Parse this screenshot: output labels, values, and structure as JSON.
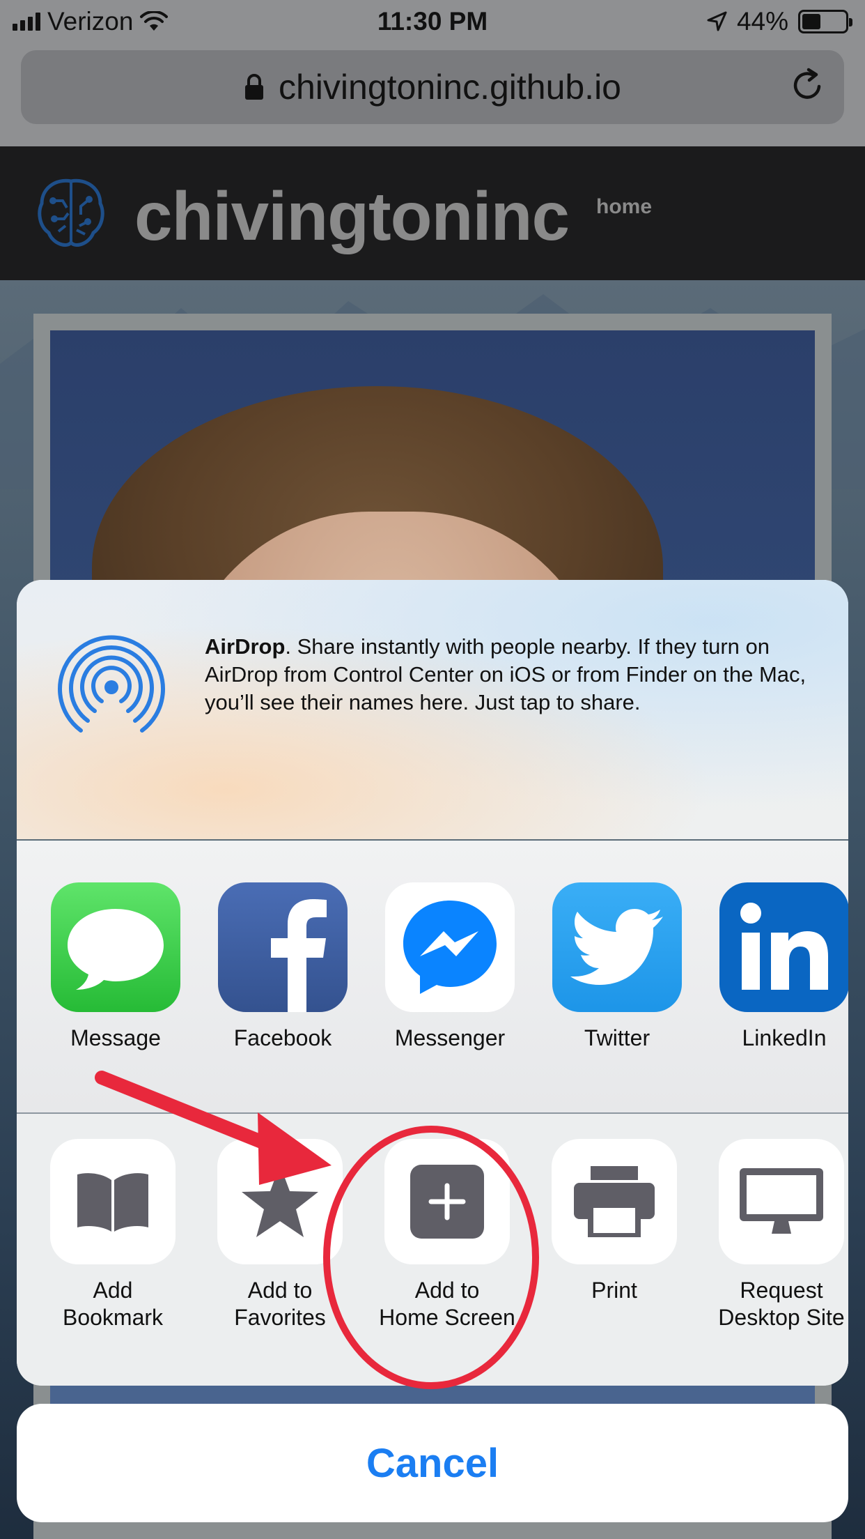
{
  "status_bar": {
    "carrier": "Verizon",
    "time": "11:30 PM",
    "battery": "44%",
    "battery_level": 0.44
  },
  "browser": {
    "url": "chivingtoninc.github.io"
  },
  "site": {
    "title": "chivingtoninc",
    "nav_home": "home"
  },
  "share_sheet": {
    "airdrop": {
      "title": "AirDrop",
      "description": ". Share instantly with people nearby. If they turn on AirDrop from Control Center on iOS or from Finder on the Mac, you’ll see their names here. Just tap to share."
    },
    "apps": [
      {
        "label": "Message",
        "icon": "messages-icon",
        "color": "#34c749"
      },
      {
        "label": "Facebook",
        "icon": "facebook-icon",
        "color": "#3b5998"
      },
      {
        "label": "Messenger",
        "icon": "messenger-icon",
        "color": "#0a84ff"
      },
      {
        "label": "Twitter",
        "icon": "twitter-icon",
        "color": "#1da1f2"
      },
      {
        "label": "LinkedIn",
        "icon": "linkedin-icon",
        "color": "#0a66c2"
      }
    ],
    "actions": [
      {
        "line1": "Add",
        "line2": "Bookmark",
        "icon": "book-icon"
      },
      {
        "line1": "Add to",
        "line2": "Favorites",
        "icon": "star-icon"
      },
      {
        "line1": "Add to",
        "line2": "Home Screen",
        "icon": "plus-square-icon"
      },
      {
        "line1": "Print",
        "line2": "",
        "icon": "printer-icon"
      },
      {
        "line1": "Request",
        "line2": "Desktop Site",
        "icon": "desktop-icon"
      }
    ],
    "cancel_label": "Cancel"
  },
  "annotation": {
    "color": "#e8283c",
    "highlighted_action": "Add to Home Screen"
  }
}
